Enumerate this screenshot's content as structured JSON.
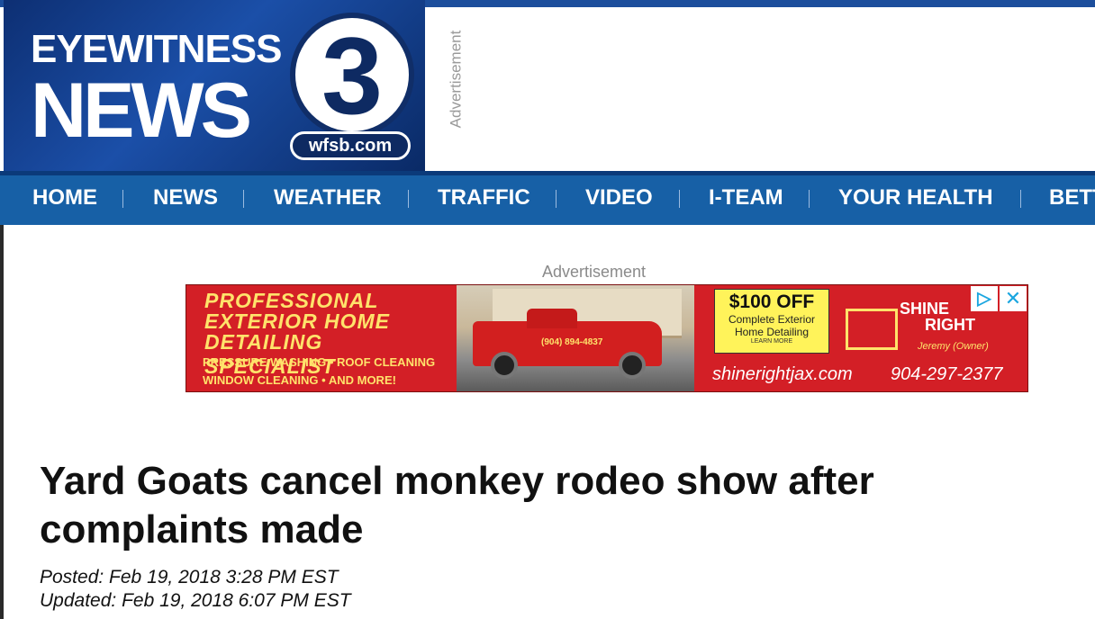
{
  "header": {
    "logo_line1": "EYEWITNESS",
    "logo_line2": "NEWS",
    "logo_channel": "3",
    "logo_domain": "wfsb.com",
    "ad_label": "Advertisement"
  },
  "nav": {
    "items": [
      "HOME",
      "NEWS",
      "WEATHER",
      "TRAFFIC",
      "VIDEO",
      "I-TEAM",
      "YOUR HEALTH",
      "BETT"
    ]
  },
  "ad": {
    "label": "Advertisement",
    "headline_lines": [
      "PROFESSIONAL",
      "EXTERIOR HOME",
      "DETAILING SPECIALIST"
    ],
    "services_lines": [
      "PRESSURE WASHING • ROOF CLEANING",
      "WINDOW CLEANING • AND MORE!"
    ],
    "truck_phone": "(904) 894-4837",
    "offer_big": "$100 OFF",
    "offer_lines": [
      "Complete Exterior",
      "Home Detailing"
    ],
    "offer_tiny": "LEARN MORE",
    "brand_name1": "SHINE",
    "brand_name2": "RIGHT",
    "brand_tag": "Jeremy (Owner)",
    "site": "shinerightjax.com",
    "phone": "904-297-2377",
    "adchoices_icon": "adchoices-icon",
    "close_icon": "close-icon"
  },
  "article": {
    "headline": "Yard Goats cancel monkey rodeo show after complaints made",
    "posted": "Posted: Feb 19, 2018 3:28 PM EST",
    "updated": "Updated: Feb 19, 2018 6:07 PM EST"
  },
  "colors": {
    "nav_bg": "#1760a6",
    "logo_bg": "#1b4fa8",
    "ad_red": "#d31f26",
    "ad_yellow": "#ffe36b"
  }
}
